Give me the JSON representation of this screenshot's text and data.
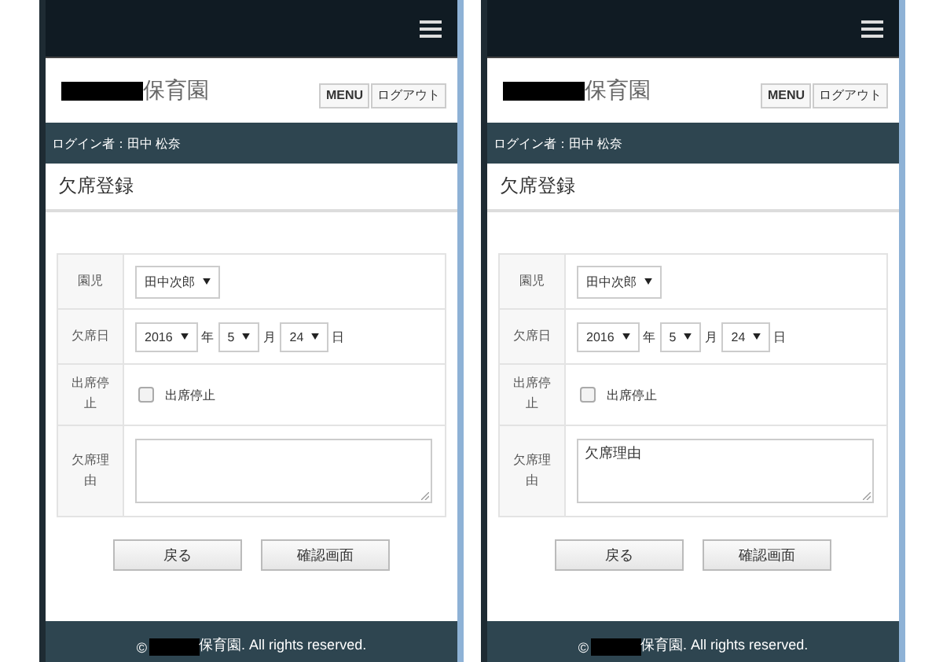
{
  "screens": [
    {
      "brand": "保育園",
      "header_buttons": [
        "MENU",
        "ログアウト"
      ],
      "login_bar": "ログイン者：田中 松奈",
      "page_title": "欠席登録",
      "rows": [
        {
          "label": "園児",
          "kind": "selects",
          "selects": [
            {
              "value": "田中次郎"
            }
          ]
        },
        {
          "label": "欠席日",
          "kind": "selects",
          "selects": [
            {
              "value": "2016",
              "unit": "年"
            },
            {
              "value": "5",
              "unit": "月"
            },
            {
              "value": "24",
              "unit": "日"
            }
          ]
        },
        {
          "label": "出席停止",
          "kind": "checkbox",
          "option": "出席停止",
          "checked": false
        },
        {
          "label": "欠席理由",
          "kind": "textarea"
        }
      ],
      "actions": [
        "戻る",
        "確認画面"
      ],
      "footer": {
        "prefix": "©",
        "suffix": "保育園. All rights reserved."
      }
    },
    {
      "brand": "保育園",
      "header_buttons": [
        "MENU",
        "ログアウト"
      ],
      "login_bar": "ログイン者：田中 松奈",
      "page_title": "欠席登録",
      "rows": [
        {
          "label": "園児",
          "kind": "selects",
          "selects": [
            {
              "value": "田中次郎"
            }
          ]
        },
        {
          "label": "欠席日",
          "kind": "selects",
          "selects": [
            {
              "value": "2016",
              "unit": "年"
            },
            {
              "value": "5",
              "unit": "月"
            },
            {
              "value": "24",
              "unit": "日"
            }
          ]
        },
        {
          "label": "出席停止",
          "kind": "checkbox",
          "option": "出席停止",
          "checked": false
        },
        {
          "label": "欠席理由",
          "kind": "textarea",
          "value": "欠席理由"
        }
      ],
      "actions": [
        "戻る",
        "確認画面"
      ],
      "footer": {
        "prefix": "©",
        "suffix": "保育園. All rights reserved."
      }
    }
  ]
}
